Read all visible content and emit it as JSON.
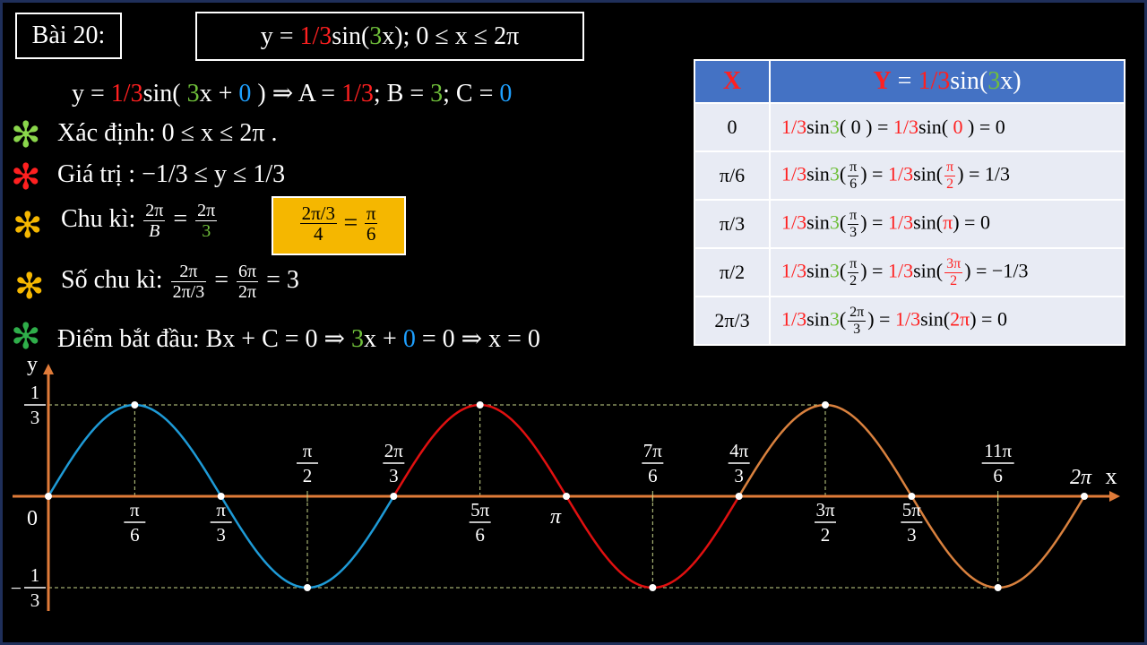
{
  "header": {
    "exercise_label": "Bài 20:",
    "function_prefix": "y = ",
    "function_amp": "1/3",
    "function_mid": "sin(",
    "function_b": "3",
    "function_suffix": "x); 0 ≤ x ≤ 2π"
  },
  "form_line": {
    "p1": "y = ",
    "a": "1/3",
    "p2": "sin( ",
    "b": "3",
    "p3": "x + ",
    "c": "0",
    "p4": " ) ⇒ A = ",
    "a2": "1/3",
    "p5": "; B = ",
    "b2": "3",
    "p6": "; C = ",
    "c2": "0"
  },
  "bullets": {
    "star_glyph": "✻",
    "domain": "Xác định: 0 ≤ x ≤ 2π .",
    "range": "Giá trị : −1/3 ≤ y ≤ 1/3",
    "period_label": "Chu kì:",
    "period_f1_num": "2π",
    "period_f1_den": "B",
    "period_eq": "=",
    "period_f2_num": "2π",
    "period_f2_den": "3",
    "hl_f1_num": "2π/3",
    "hl_f1_den": "4",
    "hl_eq": "=",
    "hl_f2_num": "π",
    "hl_f2_den": "6",
    "count_label": "Số chu kì:",
    "count_f1_num": "2π",
    "count_f1_den": "2π/3",
    "count_eq1": "=",
    "count_f2_num": "6π",
    "count_f2_den": "2π",
    "count_result": "= 3",
    "start_p1": "Điểm bắt đầu: Bx + C = 0 ⇒ ",
    "start_b": "3",
    "start_p2": "x + ",
    "start_c": "0",
    "start_p3": " = 0  ⇒ x = 0"
  },
  "table": {
    "header_x": "X",
    "header_y_p1": "Y",
    "header_y_p2": " = ",
    "header_y_a": "1/3",
    "header_y_p3": "sin(",
    "header_y_b": "3",
    "header_y_p4": "x)",
    "rows": [
      {
        "x": "0",
        "lhs_a": "1/3",
        "lhs_sin": "sin",
        "lhs_b": "3",
        "lhs_arg": "( 0 )",
        "eq1": " = ",
        "rhs_a": "1/3",
        "rhs_sin": "sin( ",
        "rhs_arg": "0",
        "rhs_close": " )",
        "result": " = 0"
      },
      {
        "x": "π/6",
        "lhs_a": "1/3",
        "lhs_sin": "sin",
        "lhs_b": "3",
        "lhs_num": "π",
        "lhs_den": "6",
        "eq1": " = ",
        "rhs_a": "1/3",
        "rhs_sin": "sin",
        "rhs_num": "π",
        "rhs_den": "2",
        "result": " = 1/3"
      },
      {
        "x": "π/3",
        "lhs_a": "1/3",
        "lhs_sin": "sin",
        "lhs_b": "3",
        "lhs_num": "π",
        "lhs_den": "3",
        "eq1": " = ",
        "rhs_a": "1/3",
        "rhs_sin": "sin(",
        "rhs_arg": "π",
        "rhs_close": ")",
        "result": " = 0"
      },
      {
        "x": "π/2",
        "lhs_a": "1/3",
        "lhs_sin": "sin",
        "lhs_b": "3",
        "lhs_num": "π",
        "lhs_den": "2",
        "eq1": " = ",
        "rhs_a": "1/3",
        "rhs_sin": "sin",
        "rhs_num": "3π",
        "rhs_den": "2",
        "result": " = −1/3"
      },
      {
        "x": "2π/3",
        "lhs_a": "1/3",
        "lhs_sin": "sin",
        "lhs_b": "3",
        "lhs_num": "2π",
        "lhs_den": "3",
        "eq1": " = ",
        "rhs_a": "1/3",
        "rhs_sin": "sin(",
        "rhs_arg": "2π",
        "rhs_close": ")",
        "result": " = 0"
      }
    ]
  },
  "colors": {
    "red": "#ff2020",
    "green": "#6fbf3a",
    "blue": "#1ea0ff",
    "axis": "#e07b39",
    "highlight": "#f5b700",
    "table_header": "#4472c4",
    "table_cell": "#e8ebf4"
  },
  "chart_data": {
    "type": "line",
    "function": "y = 1/3 sin(3x)",
    "xlim": [
      0,
      6.2832
    ],
    "ylim": [
      -0.3333,
      0.3333
    ],
    "xlabel": "x",
    "ylabel": "y",
    "origin_label": "0",
    "series": [
      {
        "period": 1,
        "x_start": 0,
        "x_end": 2.0944,
        "color": "#1e9ad6"
      },
      {
        "period": 2,
        "x_start": 2.0944,
        "x_end": 4.1888,
        "color": "#e01010"
      },
      {
        "period": 3,
        "x_start": 4.1888,
        "x_end": 6.2832,
        "color": "#d9813e"
      }
    ],
    "key_points": [
      {
        "x": 0,
        "y": 0
      },
      {
        "x": 0.5236,
        "y": 0.3333
      },
      {
        "x": 1.0472,
        "y": 0
      },
      {
        "x": 1.5708,
        "y": -0.3333
      },
      {
        "x": 2.0944,
        "y": 0
      },
      {
        "x": 2.618,
        "y": 0.3333
      },
      {
        "x": 3.1416,
        "y": 0
      },
      {
        "x": 3.6652,
        "y": -0.3333
      },
      {
        "x": 4.1888,
        "y": 0
      },
      {
        "x": 4.7124,
        "y": 0.3333
      },
      {
        "x": 5.236,
        "y": 0
      },
      {
        "x": 5.7596,
        "y": -0.3333
      },
      {
        "x": 6.2832,
        "y": 0
      }
    ],
    "y_ticks": [
      {
        "y": 0.3333,
        "sign": "",
        "num": "1",
        "den": "3"
      },
      {
        "y": -0.3333,
        "sign": "−",
        "num": "1",
        "den": "3"
      }
    ],
    "x_tick_labels": [
      {
        "x": 0.5236,
        "num": "π",
        "den": "6",
        "side": "below"
      },
      {
        "x": 1.0472,
        "num": "π",
        "den": "3",
        "side": "below"
      },
      {
        "x": 1.5708,
        "num": "π",
        "den": "2",
        "side": "above"
      },
      {
        "x": 2.0944,
        "num": "2π",
        "den": "3",
        "side": "above"
      },
      {
        "x": 2.618,
        "num": "5π",
        "den": "6",
        "side": "below"
      },
      {
        "x": 3.1416,
        "text": "π",
        "side": "below"
      },
      {
        "x": 3.6652,
        "num": "7π",
        "den": "6",
        "side": "above"
      },
      {
        "x": 4.1888,
        "num": "4π",
        "den": "3",
        "side": "above"
      },
      {
        "x": 4.7124,
        "num": "3π",
        "den": "2",
        "side": "below"
      },
      {
        "x": 5.236,
        "num": "5π",
        "den": "3",
        "side": "below"
      },
      {
        "x": 5.7596,
        "num": "11π",
        "den": "6",
        "side": "above"
      },
      {
        "x": 6.2832,
        "text": "2π",
        "side": "above"
      }
    ]
  }
}
